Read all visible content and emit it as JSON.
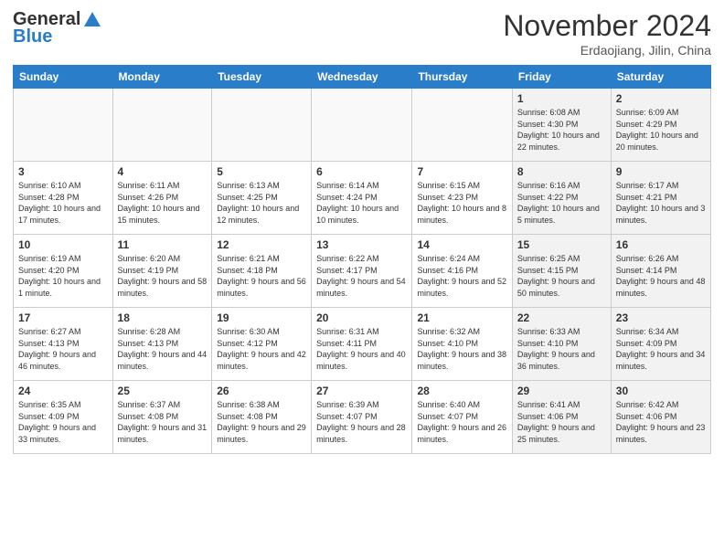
{
  "header": {
    "logo_general": "General",
    "logo_blue": "Blue",
    "month_title": "November 2024",
    "subtitle": "Erdaojiang, Jilin, China"
  },
  "weekdays": [
    "Sunday",
    "Monday",
    "Tuesday",
    "Wednesday",
    "Thursday",
    "Friday",
    "Saturday"
  ],
  "weeks": [
    [
      {
        "day": "",
        "info": "",
        "empty": true
      },
      {
        "day": "",
        "info": "",
        "empty": true
      },
      {
        "day": "",
        "info": "",
        "empty": true
      },
      {
        "day": "",
        "info": "",
        "empty": true
      },
      {
        "day": "",
        "info": "",
        "empty": true
      },
      {
        "day": "1",
        "info": "Sunrise: 6:08 AM\nSunset: 4:30 PM\nDaylight: 10 hours and 22 minutes.",
        "shaded": true
      },
      {
        "day": "2",
        "info": "Sunrise: 6:09 AM\nSunset: 4:29 PM\nDaylight: 10 hours and 20 minutes.",
        "shaded": true
      }
    ],
    [
      {
        "day": "3",
        "info": "Sunrise: 6:10 AM\nSunset: 4:28 PM\nDaylight: 10 hours and 17 minutes."
      },
      {
        "day": "4",
        "info": "Sunrise: 6:11 AM\nSunset: 4:26 PM\nDaylight: 10 hours and 15 minutes."
      },
      {
        "day": "5",
        "info": "Sunrise: 6:13 AM\nSunset: 4:25 PM\nDaylight: 10 hours and 12 minutes."
      },
      {
        "day": "6",
        "info": "Sunrise: 6:14 AM\nSunset: 4:24 PM\nDaylight: 10 hours and 10 minutes."
      },
      {
        "day": "7",
        "info": "Sunrise: 6:15 AM\nSunset: 4:23 PM\nDaylight: 10 hours and 8 minutes."
      },
      {
        "day": "8",
        "info": "Sunrise: 6:16 AM\nSunset: 4:22 PM\nDaylight: 10 hours and 5 minutes.",
        "shaded": true
      },
      {
        "day": "9",
        "info": "Sunrise: 6:17 AM\nSunset: 4:21 PM\nDaylight: 10 hours and 3 minutes.",
        "shaded": true
      }
    ],
    [
      {
        "day": "10",
        "info": "Sunrise: 6:19 AM\nSunset: 4:20 PM\nDaylight: 10 hours and 1 minute."
      },
      {
        "day": "11",
        "info": "Sunrise: 6:20 AM\nSunset: 4:19 PM\nDaylight: 9 hours and 58 minutes."
      },
      {
        "day": "12",
        "info": "Sunrise: 6:21 AM\nSunset: 4:18 PM\nDaylight: 9 hours and 56 minutes."
      },
      {
        "day": "13",
        "info": "Sunrise: 6:22 AM\nSunset: 4:17 PM\nDaylight: 9 hours and 54 minutes."
      },
      {
        "day": "14",
        "info": "Sunrise: 6:24 AM\nSunset: 4:16 PM\nDaylight: 9 hours and 52 minutes."
      },
      {
        "day": "15",
        "info": "Sunrise: 6:25 AM\nSunset: 4:15 PM\nDaylight: 9 hours and 50 minutes.",
        "shaded": true
      },
      {
        "day": "16",
        "info": "Sunrise: 6:26 AM\nSunset: 4:14 PM\nDaylight: 9 hours and 48 minutes.",
        "shaded": true
      }
    ],
    [
      {
        "day": "17",
        "info": "Sunrise: 6:27 AM\nSunset: 4:13 PM\nDaylight: 9 hours and 46 minutes."
      },
      {
        "day": "18",
        "info": "Sunrise: 6:28 AM\nSunset: 4:13 PM\nDaylight: 9 hours and 44 minutes."
      },
      {
        "day": "19",
        "info": "Sunrise: 6:30 AM\nSunset: 4:12 PM\nDaylight: 9 hours and 42 minutes."
      },
      {
        "day": "20",
        "info": "Sunrise: 6:31 AM\nSunset: 4:11 PM\nDaylight: 9 hours and 40 minutes."
      },
      {
        "day": "21",
        "info": "Sunrise: 6:32 AM\nSunset: 4:10 PM\nDaylight: 9 hours and 38 minutes."
      },
      {
        "day": "22",
        "info": "Sunrise: 6:33 AM\nSunset: 4:10 PM\nDaylight: 9 hours and 36 minutes.",
        "shaded": true
      },
      {
        "day": "23",
        "info": "Sunrise: 6:34 AM\nSunset: 4:09 PM\nDaylight: 9 hours and 34 minutes.",
        "shaded": true
      }
    ],
    [
      {
        "day": "24",
        "info": "Sunrise: 6:35 AM\nSunset: 4:09 PM\nDaylight: 9 hours and 33 minutes."
      },
      {
        "day": "25",
        "info": "Sunrise: 6:37 AM\nSunset: 4:08 PM\nDaylight: 9 hours and 31 minutes."
      },
      {
        "day": "26",
        "info": "Sunrise: 6:38 AM\nSunset: 4:08 PM\nDaylight: 9 hours and 29 minutes."
      },
      {
        "day": "27",
        "info": "Sunrise: 6:39 AM\nSunset: 4:07 PM\nDaylight: 9 hours and 28 minutes."
      },
      {
        "day": "28",
        "info": "Sunrise: 6:40 AM\nSunset: 4:07 PM\nDaylight: 9 hours and 26 minutes."
      },
      {
        "day": "29",
        "info": "Sunrise: 6:41 AM\nSunset: 4:06 PM\nDaylight: 9 hours and 25 minutes.",
        "shaded": true
      },
      {
        "day": "30",
        "info": "Sunrise: 6:42 AM\nSunset: 4:06 PM\nDaylight: 9 hours and 23 minutes.",
        "shaded": true
      }
    ]
  ]
}
